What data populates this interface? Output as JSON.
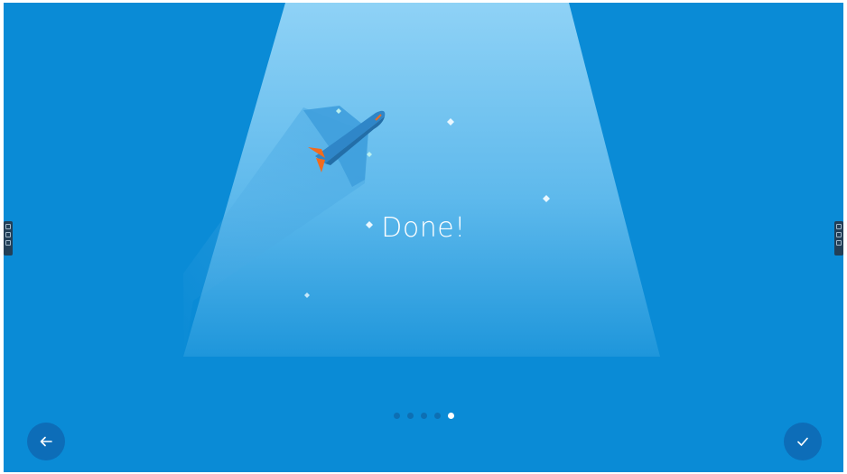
{
  "slide": {
    "title": "Done!"
  },
  "pager": {
    "total": 5,
    "active_index": 4
  },
  "buttons": {
    "back_icon": "arrow-left-icon",
    "finish_icon": "checkmark-icon"
  },
  "colors": {
    "background": "#0a8bd6",
    "button": "#0d6db8",
    "dot_inactive": "#0d6fb3",
    "dot_active": "#ffffff",
    "plane_body": "#2f86c8",
    "plane_accent": "#f26b1d"
  }
}
